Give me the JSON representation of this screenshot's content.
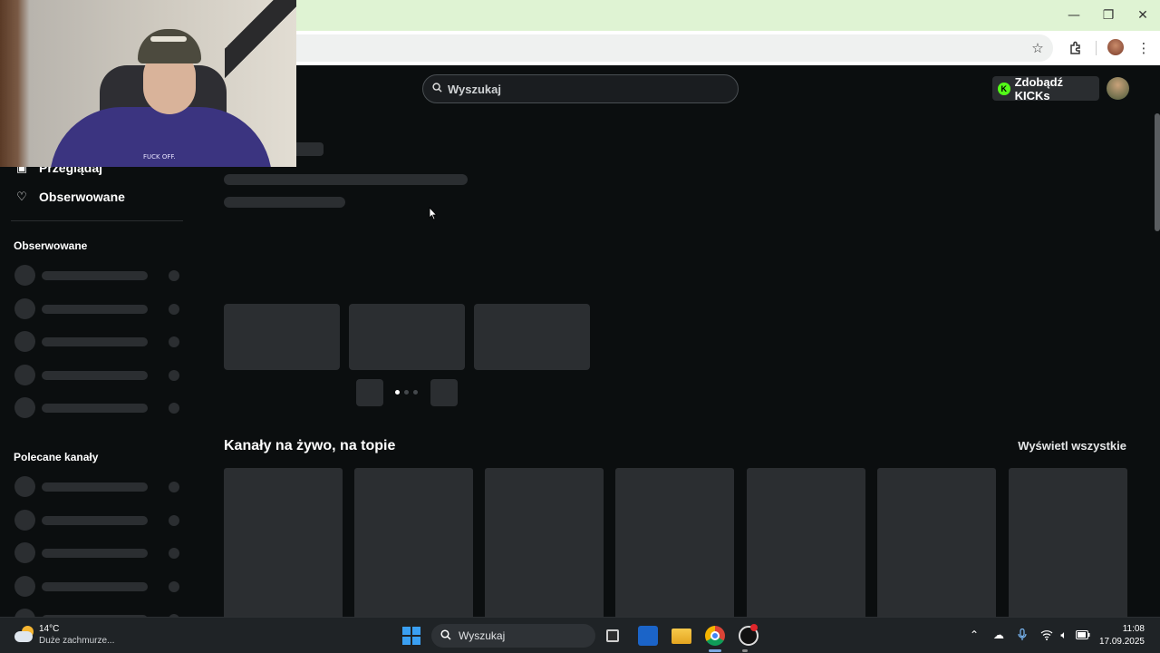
{
  "browser": {
    "window_controls": [
      "—",
      "❐",
      "✕"
    ],
    "toolbar_icons": [
      "star-icon",
      "extensions-icon",
      "menu-icon"
    ]
  },
  "header": {
    "search_placeholder": "Wyszukaj",
    "kicks_button_label": "Zdobądź KICKs",
    "kicks_icon_letter": "K",
    "accent_color": "#53fc18"
  },
  "sidebar": {
    "nav_items": [
      {
        "label": "Przeglądaj",
        "icon": "browse-icon"
      },
      {
        "label": "Obserwowane",
        "icon": "heart-icon"
      }
    ],
    "followed_title": "Obserwowane",
    "recommended_title": "Polecane kanały"
  },
  "main": {
    "section_title": "Kanały na żywo, na topie",
    "view_all_label": "Wyświetl wszystkie",
    "carousel_active_dot": 1
  },
  "webcam": {
    "hoodie_text": "FUCK OFF."
  },
  "taskbar": {
    "weather_temp": "14°C",
    "weather_desc": "Duże zachmurze...",
    "search_placeholder": "Wyszukaj",
    "time": "11:08",
    "date": "17.09.2025",
    "tray_icons": [
      "chevron-up-icon",
      "onedrive-icon",
      "microphone-icon",
      "wifi-icon",
      "speaker-icon",
      "battery-icon"
    ]
  }
}
